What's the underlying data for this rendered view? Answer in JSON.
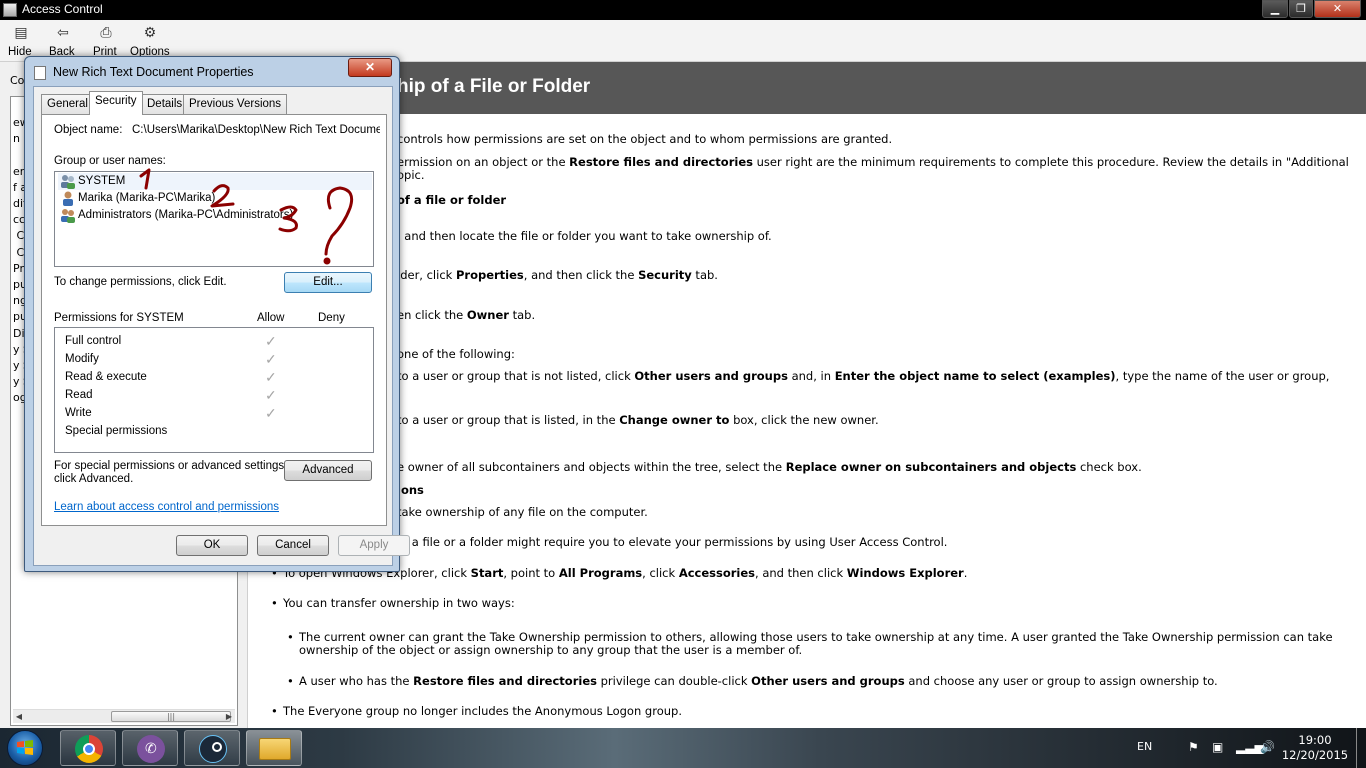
{
  "window": {
    "title": "Access Control",
    "controls": {
      "minimize": "▁",
      "maximize": "❐",
      "close": "✕"
    }
  },
  "toolbar": {
    "buttons": [
      {
        "label": "Hide",
        "icon": "hide-icon"
      },
      {
        "label": "Back",
        "icon": "back-arrow-icon"
      },
      {
        "label": "Print",
        "icon": "printer-icon"
      },
      {
        "label": "Options",
        "icon": "options-icon"
      }
    ]
  },
  "left_pane": {
    "tab_fragment": "Co",
    "tree_fragments": "ew\nn\n\ners\nf a\nditi\ncc\n Co\n Co\nPro\npu\nng\npu\nDial\ny S\ny S\ny S\nog"
  },
  "help": {
    "heading": "hip of a File or Folder",
    "lines": [
      {
        "parts": [
          {
            "t": " controls how permissions are set on the object and to whom permissions are granted."
          }
        ]
      },
      {
        "parts": [
          {
            "t": "ermission on an object or the "
          },
          {
            "t": "Restore files and directories",
            "b": true
          },
          {
            "t": " user right are the minimum requirements to complete this procedure. Review the details in \"Additional"
          }
        ]
      },
      {
        "parts": [
          {
            "t": "opic."
          }
        ]
      },
      {
        "parts": [
          {
            "t": " of a file or folder",
            "b": true
          }
        ]
      },
      {
        "parts": [
          {
            "t": ", and then locate the file or folder you want to take ownership of."
          }
        ]
      },
      {
        "parts": [
          {
            "t": "lder, click "
          },
          {
            "t": "Properties",
            "b": true
          },
          {
            "t": ", and then click the "
          },
          {
            "t": "Security",
            "b": true
          },
          {
            "t": " tab."
          }
        ]
      },
      {
        "parts": [
          {
            "t": "en click the "
          },
          {
            "t": "Owner",
            "b": true
          },
          {
            "t": " tab."
          }
        ]
      },
      {
        "parts": [
          {
            "t": "one of the following:"
          }
        ]
      },
      {
        "parts": [
          {
            "t": " to a user or group that is not listed, click "
          },
          {
            "t": "Other users and groups",
            "b": true
          },
          {
            "t": " and, in "
          },
          {
            "t": "Enter the object name to select (examples)",
            "b": true
          },
          {
            "t": ", type the name of the user or group,"
          }
        ]
      },
      {
        "parts": [
          {
            "t": " to a user or group that is listed, in the "
          },
          {
            "t": "Change owner to",
            "b": true
          },
          {
            "t": " box, click the new owner."
          }
        ]
      },
      {
        "parts": [
          {
            "t": "e owner of all subcontainers and objects within the tree, select the "
          },
          {
            "t": "Replace owner on subcontainers and objects",
            "b": true
          },
          {
            "t": " check box."
          }
        ]
      },
      {
        "parts": [
          {
            "t": "ions",
            "b": true
          }
        ]
      },
      {
        "parts": [
          {
            "t": " take ownership of any file on the computer."
          }
        ]
      },
      {
        "parts": [
          {
            "t": " of a file or a folder might require you to elevate your permissions by using User Access Control."
          }
        ]
      },
      {
        "parts": [
          {
            "t": "To open Windows Explorer, click "
          },
          {
            "t": "Start",
            "b": true
          },
          {
            "t": ", point to "
          },
          {
            "t": "All Programs",
            "b": true
          },
          {
            "t": ", click "
          },
          {
            "t": "Accessories",
            "b": true
          },
          {
            "t": ", and then click "
          },
          {
            "t": "Windows Explorer",
            "b": true
          },
          {
            "t": "."
          }
        ]
      },
      {
        "parts": [
          {
            "t": "You can transfer ownership in two ways:"
          }
        ]
      },
      {
        "parts": [
          {
            "t": "The current owner can grant the Take Ownership permission to others, allowing those users to take ownership at any time. A user granted the Take Ownership permission can take"
          }
        ]
      },
      {
        "parts": [
          {
            "t": "ownership of the object or assign ownership to any group that the user is a member of."
          }
        ]
      },
      {
        "parts": [
          {
            "t": "A user who has the "
          },
          {
            "t": "Restore files and directories",
            "b": true
          },
          {
            "t": " privilege can double-click "
          },
          {
            "t": "Other users and groups",
            "b": true
          },
          {
            "t": " and choose any user or group to assign ownership to."
          }
        ]
      },
      {
        "parts": [
          {
            "t": "The Everyone group no longer includes the Anonymous Logon group."
          }
        ]
      }
    ]
  },
  "dialog": {
    "title": "New Rich Text Document Properties",
    "close": "✕",
    "tabs": [
      "General",
      "Security",
      "Details",
      "Previous Versions"
    ],
    "active_tab": "Security",
    "object_name_label": "Object name:",
    "object_name_value": "C:\\Users\\Marika\\Desktop\\New Rich Text Docume",
    "groups_label": "Group or user names:",
    "users": [
      {
        "name": "SYSTEM",
        "icon": "users-group-icon"
      },
      {
        "name": "Marika (Marika-PC\\Marika)",
        "icon": "user-icon"
      },
      {
        "name": "Administrators (Marika-PC\\Administrators)",
        "icon": "users-group-icon"
      }
    ],
    "change_perm_text": "To change permissions, click Edit.",
    "edit_button": "Edit...",
    "permissions_label": "Permissions for SYSTEM",
    "allow_label": "Allow",
    "deny_label": "Deny",
    "permissions": [
      {
        "name": "Full control",
        "allow": "✓"
      },
      {
        "name": "Modify",
        "allow": "✓"
      },
      {
        "name": "Read & execute",
        "allow": "✓"
      },
      {
        "name": "Read",
        "allow": "✓"
      },
      {
        "name": "Write",
        "allow": "✓"
      },
      {
        "name": "Special permissions",
        "allow": ""
      }
    ],
    "special_text_1": "For special permissions or advanced settings,",
    "special_text_2": "click Advanced.",
    "advanced_button": "Advanced",
    "learn_link": "Learn about access control and permissions",
    "ok_button": "OK",
    "cancel_button": "Cancel",
    "apply_button": "Apply"
  },
  "annotations": {
    "one": "1",
    "two": "2",
    "three": "3",
    "question": "?",
    "color": "#8b0000"
  },
  "taskbar": {
    "apps": [
      "chrome-icon",
      "viber-icon",
      "steam-icon",
      "windows-explorer-icon"
    ],
    "language": "EN",
    "time": "19:00",
    "date": "12/20/2015"
  }
}
